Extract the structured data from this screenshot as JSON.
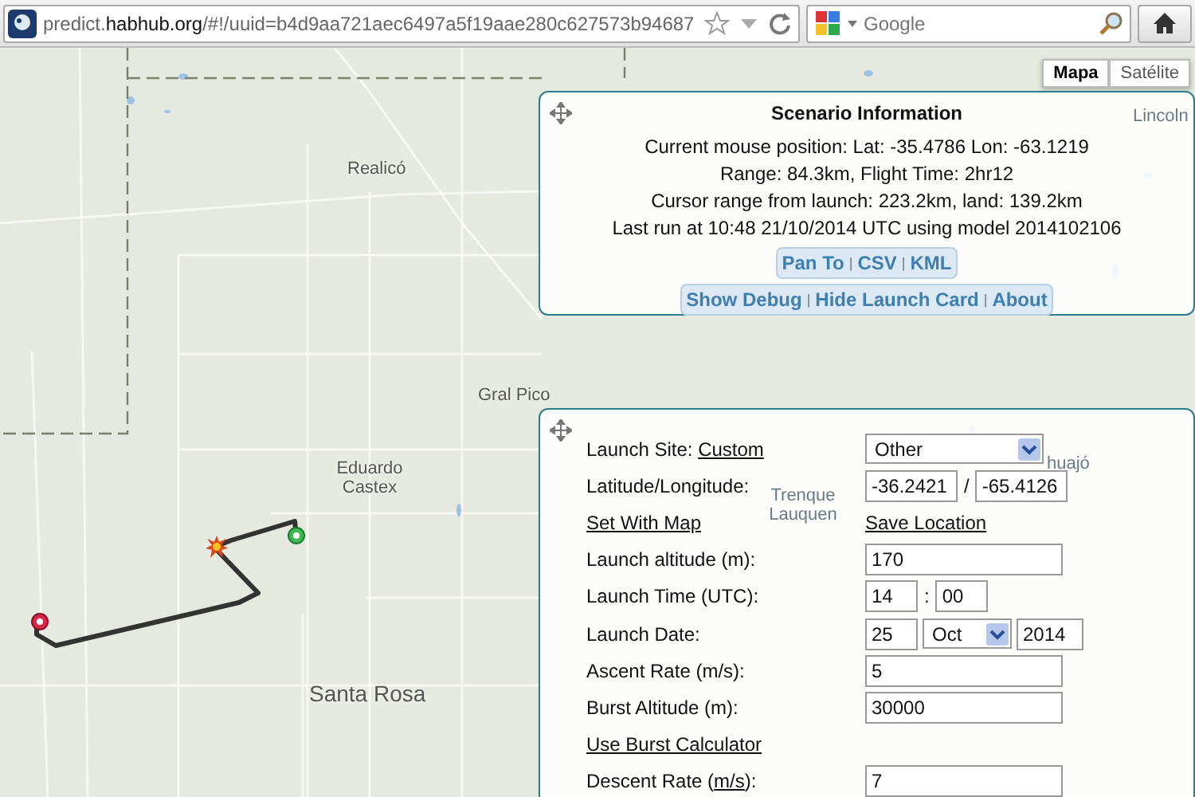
{
  "browser": {
    "url": [
      {
        "text": "predict.",
        "kind": "plain"
      },
      {
        "text": "habhub.org",
        "kind": "domain"
      },
      {
        "text": "/#!/uuid=b4d9aa721aec6497a5f19aae280c627573b94687",
        "kind": "plain"
      }
    ],
    "search_placeholder": "Google"
  },
  "map_types": [
    {
      "label": "Mapa",
      "selected": true
    },
    {
      "label": "Satélite",
      "selected": false
    }
  ],
  "map": {
    "places": [
      {
        "name": "Realicó"
      },
      {
        "name": "Gral Pico"
      },
      {
        "name": "Eduardo Castex"
      },
      {
        "name": "Santa Rosa"
      },
      {
        "name": "Lincoln"
      },
      {
        "name": "Trenque Lauquen"
      },
      {
        "name": "huajó"
      }
    ]
  },
  "scenario": {
    "title": "Scenario Information",
    "lines": [
      "Current mouse position: Lat: -35.4786 Lon: -63.1219",
      "Range: 84.3km, Flight Time: 2hr12",
      "Cursor range from launch: 223.2km, land: 139.2km",
      "Last run at 10:48 21/10/2014 UTC using model 2014102106"
    ],
    "separator": "|",
    "link_groups": [
      [
        "Pan To",
        "CSV",
        "KML"
      ],
      [
        "Show Debug",
        "Hide Launch Card",
        "About"
      ]
    ]
  },
  "launch_card": {
    "rows": [
      {
        "kind": "select",
        "label": "Launch Site: ",
        "label_link": "Custom",
        "label_after": "",
        "value": "Other"
      },
      {
        "kind": "pair",
        "label": "Latitude/Longitude:",
        "values": [
          "-36.2421",
          "-65.4126"
        ],
        "separator": "/"
      },
      {
        "kind": "links",
        "links": [
          "Set With Map",
          "Save Location"
        ]
      },
      {
        "kind": "input",
        "label": "Launch altitude (m):",
        "value": "170"
      },
      {
        "kind": "time",
        "label": "Launch Time (UTC):",
        "values": [
          "14",
          "00"
        ],
        "separator": ":"
      },
      {
        "kind": "date",
        "label": "Launch Date:",
        "day": "25",
        "month": "Oct",
        "year": "2014"
      },
      {
        "kind": "input",
        "label": "Ascent Rate (m/s):",
        "value": "5"
      },
      {
        "kind": "input",
        "label": "Burst Altitude (m):",
        "value": "30000"
      },
      {
        "kind": "link",
        "link": "Use Burst Calculator"
      },
      {
        "kind": "input",
        "label": "Descent Rate (",
        "label_link": "m/s",
        "label_after": "):",
        "value": "7"
      }
    ]
  }
}
